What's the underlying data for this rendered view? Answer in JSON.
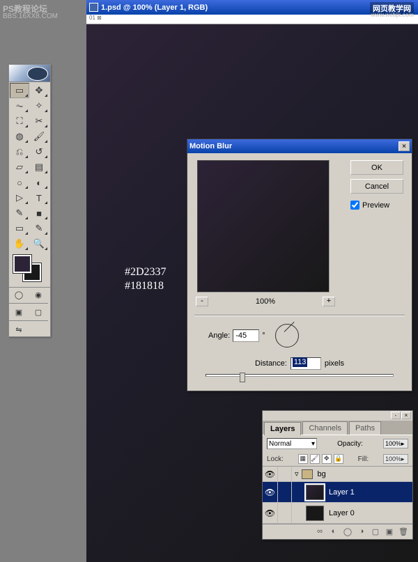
{
  "watermark": {
    "line1": "PS教程论坛",
    "line2": "BBS.16XX8.COM",
    "right1": "网页教学网",
    "right2": "www.webjx.com"
  },
  "window": {
    "title": "1.psd @ 100% (Layer 1, RGB)",
    "ruler0": "01"
  },
  "canvas_colors": {
    "fg": "#2D2337",
    "bg": "#181818"
  },
  "toolbox": {
    "tools": [
      [
        "rect-marquee",
        "▭",
        "move",
        "✥"
      ],
      [
        "lasso",
        "⏦",
        "wand",
        "✧"
      ],
      [
        "crop",
        "⛶",
        "slice",
        "✂"
      ],
      [
        "heal",
        "◍",
        "brush",
        "🖌"
      ],
      [
        "stamp",
        "⎌",
        "history",
        "↺"
      ],
      [
        "eraser",
        "▱",
        "gradient",
        "▤"
      ],
      [
        "blur",
        "○",
        "dodge",
        "◐"
      ],
      [
        "path-sel",
        "▷",
        "type",
        "T"
      ],
      [
        "pen",
        "✎",
        "shape",
        "■"
      ],
      [
        "notes",
        "▭",
        "eyedrop",
        "✎"
      ],
      [
        "hand",
        "✋",
        "zoom",
        "🔍"
      ]
    ]
  },
  "dialog": {
    "title": "Motion Blur",
    "ok": "OK",
    "cancel": "Cancel",
    "preview": "Preview",
    "zoom": "100%",
    "angle_label": "Angle:",
    "angle": "-45",
    "deg": "°",
    "distance_label": "Distance:",
    "distance": "113",
    "pixels": "pixels"
  },
  "layers": {
    "tabs": [
      "Layers",
      "Channels",
      "Paths"
    ],
    "blend": "Normal",
    "opacity_label": "Opacity:",
    "opacity": "100%",
    "lock": "Lock:",
    "fill_label": "Fill:",
    "fill": "100%",
    "items": [
      {
        "name": "bg",
        "type": "group"
      },
      {
        "name": "Layer 1",
        "type": "layer",
        "selected": true
      },
      {
        "name": "Layer 0",
        "type": "layer"
      }
    ]
  }
}
